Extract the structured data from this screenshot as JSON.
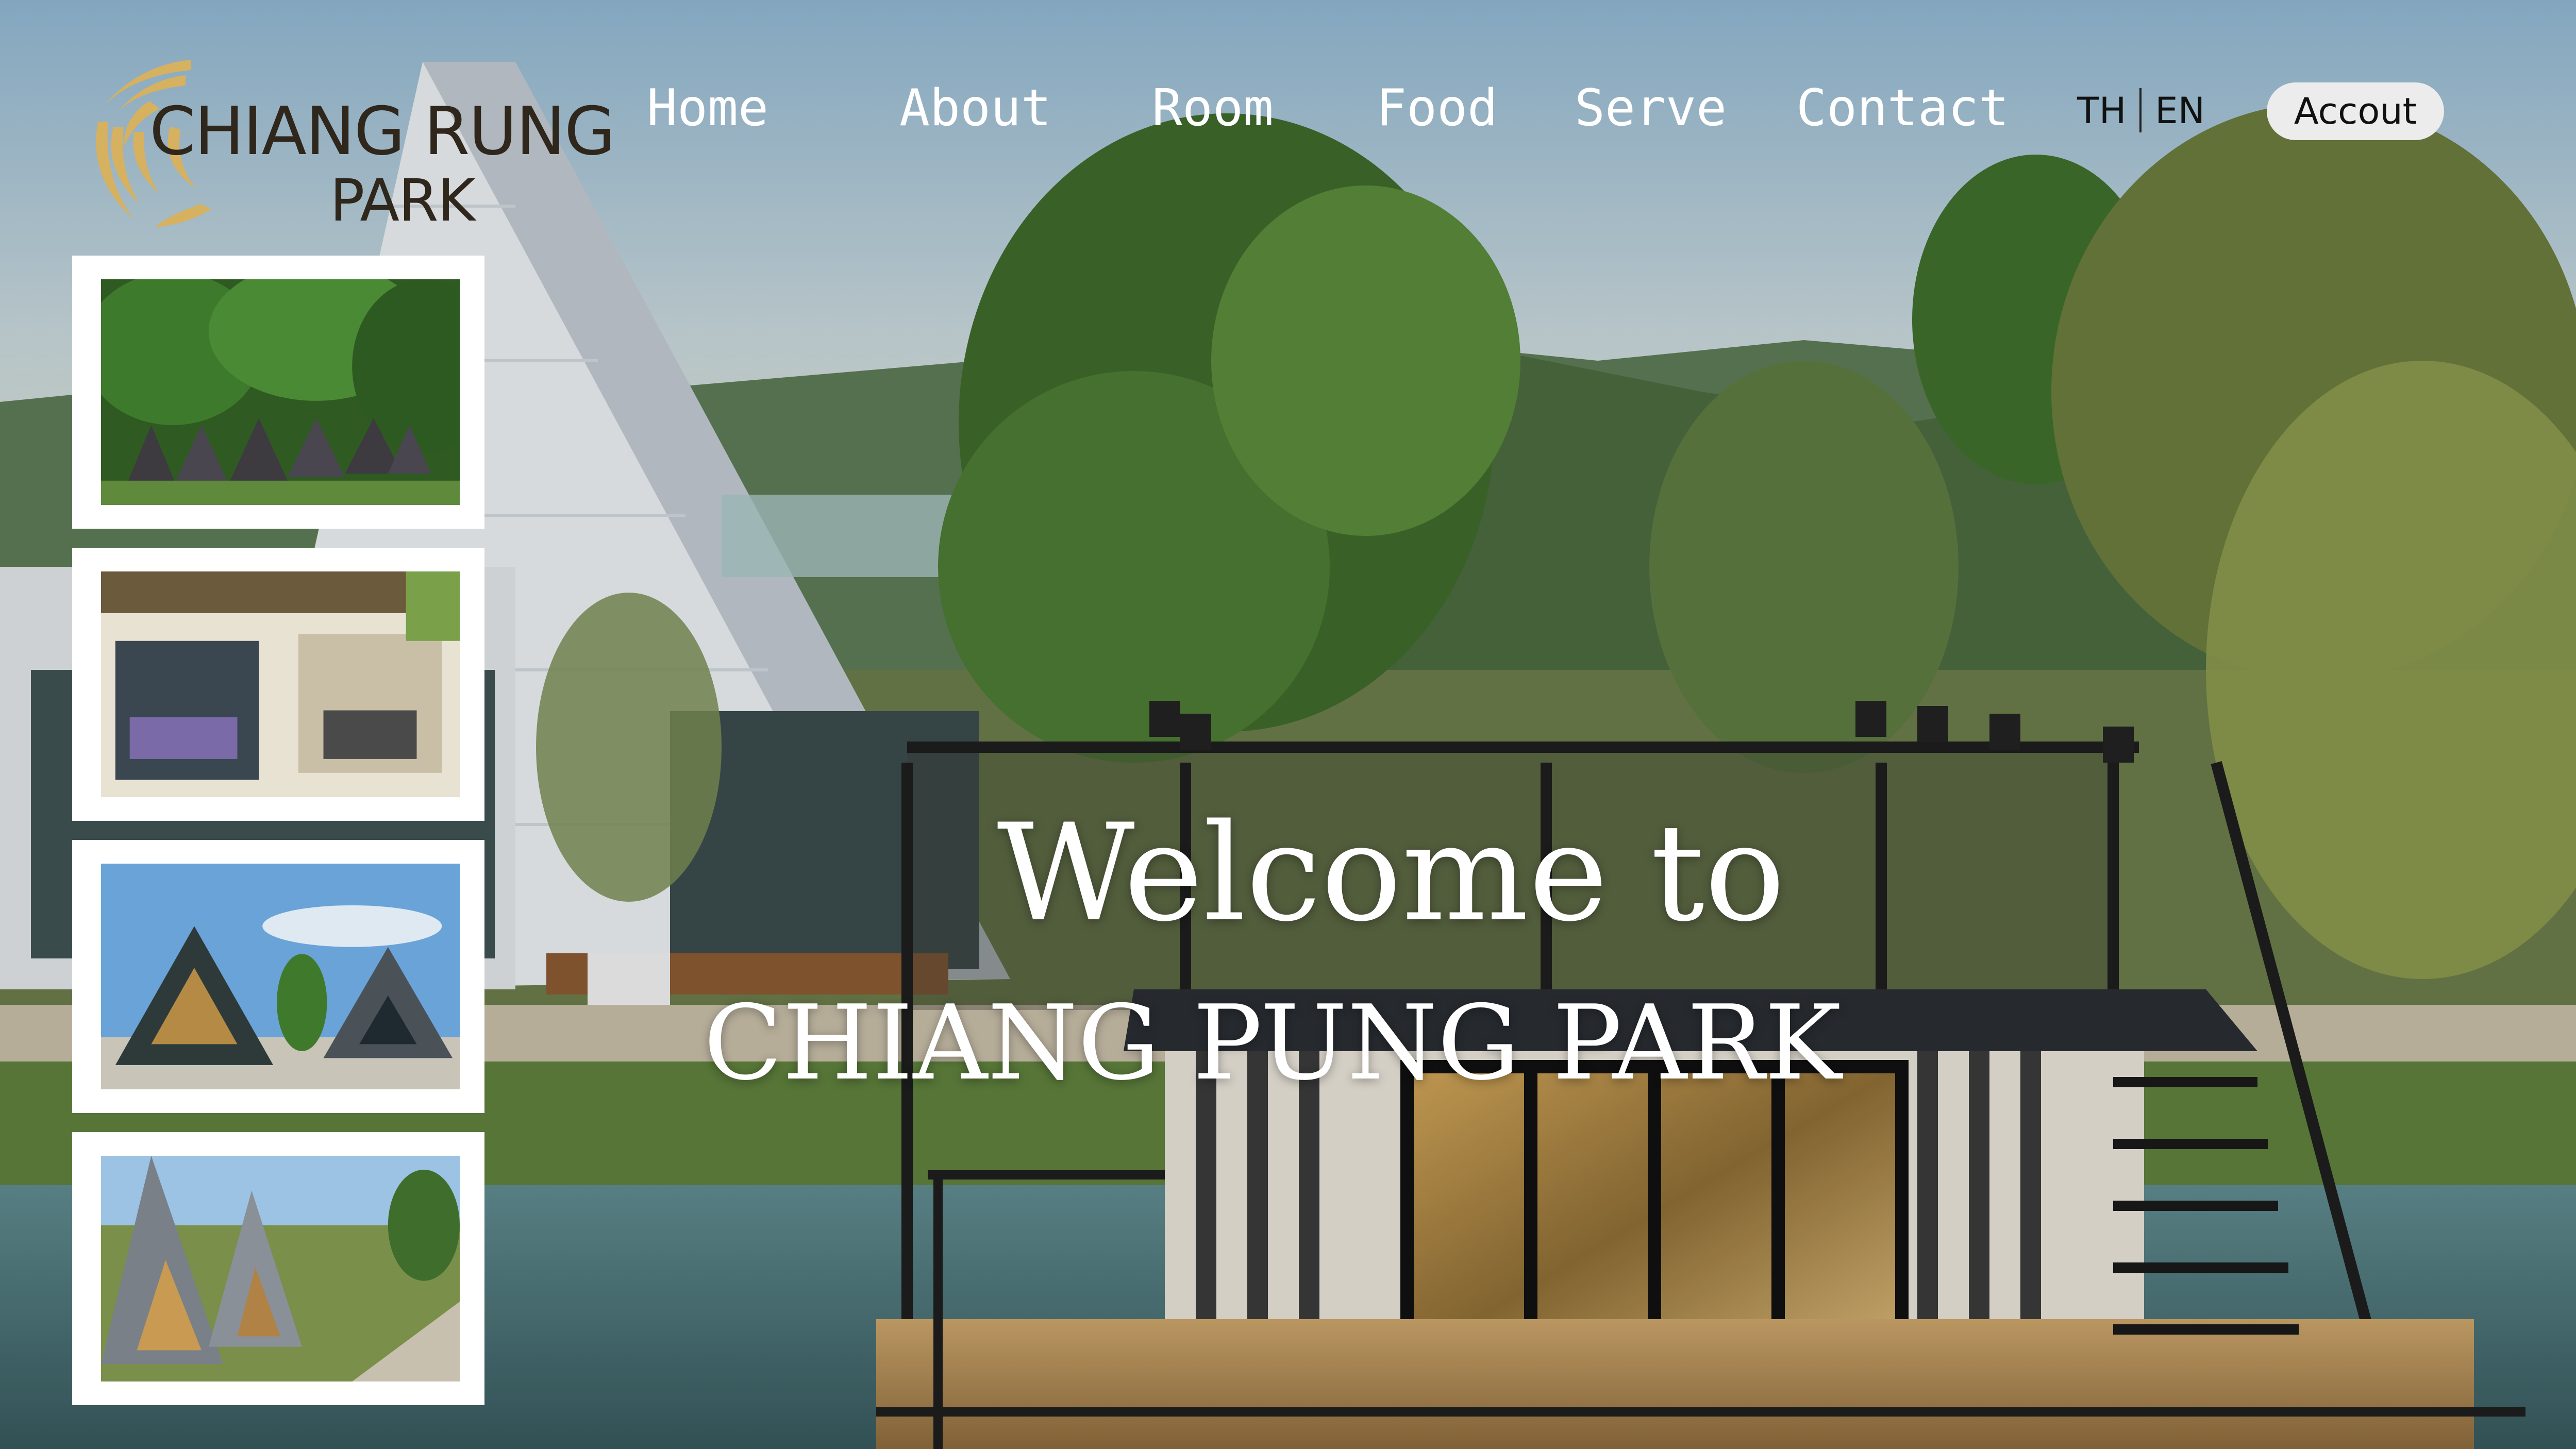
{
  "brand": {
    "line1": "CHIANG RUNG",
    "line2": "PARK"
  },
  "nav": {
    "items": [
      {
        "label": "Home"
      },
      {
        "label": "About"
      },
      {
        "label": "Room"
      },
      {
        "label": "Food"
      },
      {
        "label": "Serve"
      },
      {
        "label": "Contact"
      }
    ]
  },
  "language": {
    "th": "TH",
    "en": "EN"
  },
  "account_label": "Accout",
  "hero": {
    "welcome_line": "Welcome to",
    "title_line": "CHIANG PUNG PARK"
  },
  "colors": {
    "logo_gold": "#d6b15f",
    "logo_text": "#2f261c",
    "nav_text": "#ffffff",
    "account_bg": "#ececec"
  },
  "icons": {
    "logo_mark": "gold-sunburst-logo-icon"
  }
}
